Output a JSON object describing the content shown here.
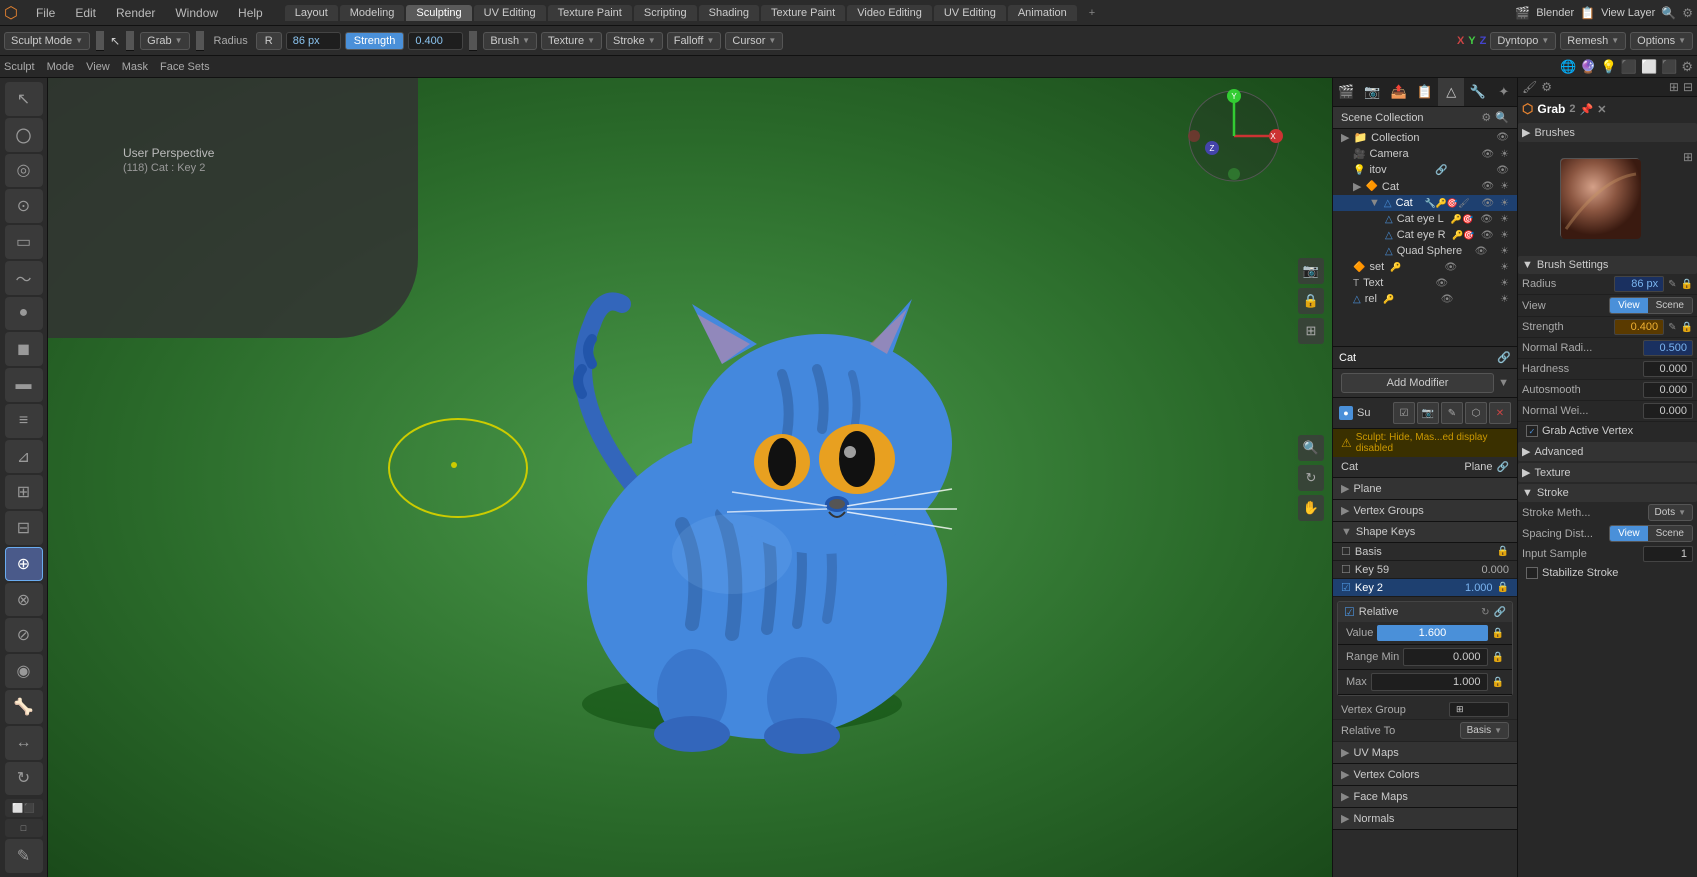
{
  "app": {
    "title": "Blender",
    "mode": "Sculpt Mode",
    "tool": "Grab",
    "workspace_tabs": [
      "Layout",
      "Modeling",
      "Sculpting",
      "UV Editing",
      "Texture Paint",
      "Scripting",
      "Shading",
      "Texture Paint",
      "Video Editing",
      "UV Editing",
      "Animation"
    ]
  },
  "toolbar": {
    "mode_label": "Sculpt Mode",
    "tool_name": "Grab",
    "radius_label": "Radius",
    "radius_value": "86 px",
    "strength_label": "Strength",
    "strength_value": "0.400",
    "brush_label": "Brush",
    "texture_label": "Texture",
    "stroke_label": "Stroke",
    "falloff_label": "Falloff",
    "cursor_label": "Cursor"
  },
  "mode_header": {
    "sculpt_label": "Sculpt",
    "mode_label": "Mode",
    "view_label": "View",
    "mask_label": "Mask",
    "face_sets_label": "Face Sets"
  },
  "viewport": {
    "perspective_label": "User Perspective",
    "object_info": "(118) Cat : Key 2",
    "axes": {
      "x": "X",
      "y": "Y",
      "z": "Z"
    }
  },
  "outliner": {
    "title": "Scene Collection",
    "items": [
      {
        "name": "Collection",
        "icon": "📁",
        "level": 0
      },
      {
        "name": "Camera",
        "icon": "🎥",
        "level": 1
      },
      {
        "name": "itov",
        "icon": "💡",
        "level": 1
      },
      {
        "name": "Cat",
        "icon": "🔶",
        "level": 1
      },
      {
        "name": "Cat",
        "icon": "△",
        "level": 2,
        "selected": true
      },
      {
        "name": "Cat eye L",
        "icon": "△",
        "level": 3
      },
      {
        "name": "Cat eye R",
        "icon": "△",
        "level": 3
      },
      {
        "name": "Quad Sphere",
        "icon": "△",
        "level": 3
      },
      {
        "name": "set",
        "icon": "🔶",
        "level": 1
      },
      {
        "name": "Text",
        "icon": "T",
        "level": 1
      },
      {
        "name": "rel",
        "icon": "△",
        "level": 1
      }
    ]
  },
  "properties": {
    "object_name": "Cat",
    "modifier": {
      "add_label": "Add Modifier",
      "name": "Su",
      "warning": "Sculpt: Hide, Mas...ed display disabled"
    },
    "plane_section": {
      "cat_label": "Cat",
      "plane_label": "Plane"
    },
    "plane_label": "Plane",
    "vertex_groups_label": "Vertex Groups",
    "shape_keys_label": "Shape Keys",
    "shape_keys": [
      {
        "name": "Basis",
        "value": ""
      },
      {
        "name": "Key 59",
        "value": "0.000"
      },
      {
        "name": "Key 2",
        "value": "1.000",
        "selected": true
      }
    ],
    "relative_section": {
      "label": "Relative",
      "value": "1.600",
      "range_min_label": "Range Min",
      "range_min_value": "0.000",
      "max_label": "Max",
      "max_value": "1.000"
    },
    "vertex_group": {
      "label": "Vertex Group",
      "icon": "grid"
    },
    "relative_to": {
      "label": "Relative To",
      "value": "Basis"
    },
    "uv_maps_label": "UV Maps",
    "vertex_colors_label": "Vertex Colors",
    "face_maps_label": "Face Maps",
    "normals_label": "Normals"
  },
  "brush_settings": {
    "panel_title": "Grab",
    "brushes_label": "Brushes",
    "brush_name": "Grab",
    "settings_label": "Brush Settings",
    "radius_label": "Radius",
    "radius_value": "86 px",
    "radius_unit_options": [
      "View",
      "Scene"
    ],
    "radius_unit_active": "View",
    "strength_label": "Strength",
    "strength_value": "0.400",
    "normal_radius_label": "Normal Radi...",
    "normal_radius_value": "0.500",
    "hardness_label": "Hardness",
    "hardness_value": "0.000",
    "autosmooth_label": "Autosmooth",
    "autosmooth_value": "0.000",
    "normal_weight_label": "Normal Wei...",
    "normal_weight_value": "0.000",
    "grab_active_vertex_label": "Grab Active Vertex",
    "advanced_label": "Advanced",
    "texture_label": "Texture",
    "stroke_label": "Stroke",
    "stroke_method_label": "Stroke Meth...",
    "stroke_method_value": "Dots",
    "spacing_dist_label": "Spacing Dist...",
    "spacing_dist_value": "View",
    "spacing_dist_scene": "Scene",
    "input_sample_label": "Input Sample",
    "input_sample_value": "1",
    "stabilize_stroke_label": "Stabilize Stroke"
  }
}
